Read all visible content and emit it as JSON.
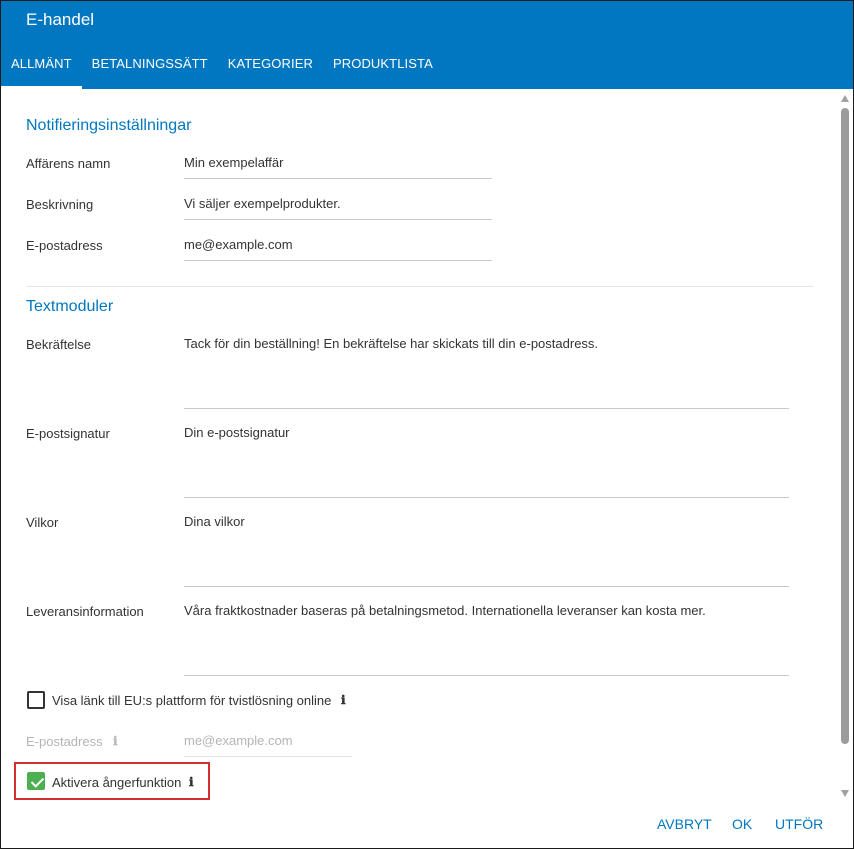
{
  "dialog": {
    "title": "E-handel"
  },
  "tabs": [
    {
      "label": "ALLMÄNT",
      "active": true
    },
    {
      "label": "BETALNINGSSÄTT",
      "active": false
    },
    {
      "label": "KATEGORIER",
      "active": false
    },
    {
      "label": "PRODUKTLISTA",
      "active": false
    }
  ],
  "notifications": {
    "title": "Notifieringsinställningar",
    "shop_name_label": "Affärens namn",
    "shop_name_value": "Min exempelaffär",
    "description_label": "Beskrivning",
    "description_value": "Vi säljer exempelprodukter.",
    "email_label": "E-postadress",
    "email_value": "me@example.com"
  },
  "text_modules": {
    "title": "Textmoduler",
    "confirmation_label": "Bekräftelse",
    "confirmation_value": "Tack för din beställning! En bekräftelse har skickats till din e-postadress.",
    "signature_label": "E-postsignatur",
    "signature_value": "Din e-postsignatur",
    "terms_label": "Vilkor",
    "terms_value": "Dina vilkor",
    "delivery_label": "Leveransinformation",
    "delivery_value": "Våra fraktkostnader baseras på betalningsmetod. Internationella leveranser kan kosta mer."
  },
  "eu_platform": {
    "label": "Visa länk till EU:s plattform för tvistlösning online",
    "checked": false,
    "email_label": "E-postadress",
    "email_placeholder": "me@example.com"
  },
  "undo": {
    "label": "Aktivera ångerfunktion",
    "checked": true
  },
  "footer": {
    "cancel": "AVBRYT",
    "ok": "OK",
    "apply": "UTFÖR"
  },
  "icons": {
    "info": "ℹ"
  },
  "colors": {
    "header": "#0077c0",
    "accent": "#0077c0",
    "checkbox_checked": "#4caf50",
    "highlight": "#d32f2f"
  }
}
